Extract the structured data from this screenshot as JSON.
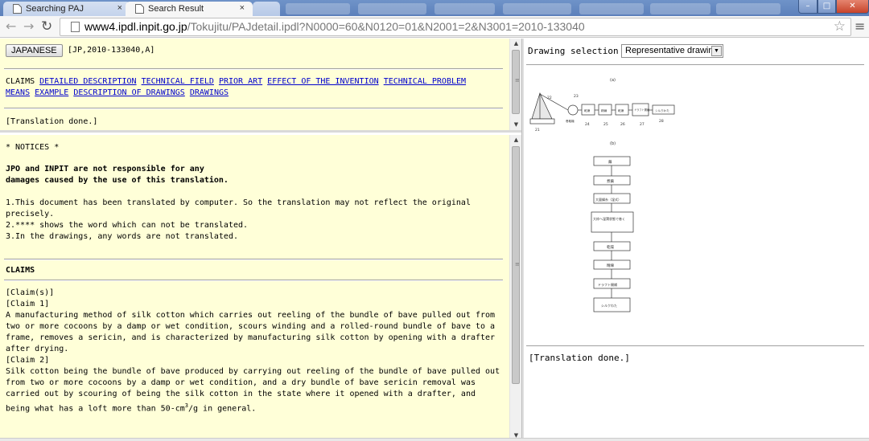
{
  "tabs": [
    {
      "label": "Searching PAJ",
      "close": "×"
    },
    {
      "label": "Search Result",
      "close": "×"
    }
  ],
  "window_controls": {
    "minimize": "–",
    "maximize": "□",
    "close": "✕"
  },
  "url": {
    "host": "www4.ipdl.inpit.go.jp",
    "path": "/Tokujitu/PAJdetail.ipdl?N0000=60&N0120=01&N2001=2&N3001=2010-133040"
  },
  "top_frame": {
    "japanese_button": "JAPANESE",
    "doc_number": "[JP,2010-133040,A]",
    "links": [
      "CLAIMS",
      "DETAILED DESCRIPTION",
      "TECHNICAL FIELD",
      "PRIOR ART",
      "EFFECT OF THE INVENTION",
      "TECHNICAL PROBLEM",
      "MEANS",
      "EXAMPLE",
      "DESCRIPTION OF DRAWINGS",
      "DRAWINGS"
    ],
    "translation_status": "[Translation done.]"
  },
  "main_frame": {
    "notices": "* NOTICES *",
    "disclaimer_1": "JPO and INPIT are not responsible for any",
    "disclaimer_2": "damages caused by the use of this translation.",
    "note_1": "1.This document has been translated by computer. So the translation may not reflect the original precisely.",
    "note_2": "2.**** shows the word which can not be translated.",
    "note_3": "3.In the drawings, any words are not translated.",
    "claims_heading": "CLAIMS",
    "claims_label": "[Claim(s)]",
    "claim1_label": "[Claim 1]",
    "claim1_text": "A manufacturing method of silk cotton which carries out reeling of the bundle of bave pulled out from two or more cocoons by a damp or wet condition, scours winding and a rolled-round bundle of bave to a frame, removes a sericin, and is characterized by manufacturing silk cotton by opening with a drafter after drying.",
    "claim2_label": "[Claim 2]",
    "claim2_text_a": "Silk cotton being the bundle of bave produced by carrying out reeling of the bundle of bave pulled out from two or more cocoons by a damp or wet condition, and a dry bundle of bave sericin removal was carried out by scouring of being the silk cotton in the state where it opened with a drafter, and being what has a loft more than 50-cm",
    "claim2_sup": "3",
    "claim2_text_b": "/g in general."
  },
  "right_frame": {
    "drawing_selection_label": "Drawing selection",
    "drawing_selection_value": "Representative drawing",
    "translation_status": "[Translation done.]",
    "drawing": {
      "label_a": "(a)",
      "label_b": "(b)",
      "a_boxes": [
        "乾燥",
        "精練",
        "乾燥",
        "ドラフト開繊",
        "シルクわた"
      ],
      "a_numbers": [
        "21",
        "22",
        "23",
        "24",
        "25",
        "26",
        "27",
        "28"
      ],
      "a_small": "巻取機",
      "b_boxes": [
        "繭",
        "煮繭",
        "大量繰糸（湿式）",
        "大枠へ湿潤状態で巻く",
        "乾燥",
        "精練",
        "ドラフト開繊",
        "シルクわた"
      ]
    }
  },
  "icons": {
    "back": "back-arrow-icon",
    "forward": "forward-arrow-icon",
    "reload": "reload-icon",
    "star": "star-icon",
    "menu": "menu-icon"
  }
}
